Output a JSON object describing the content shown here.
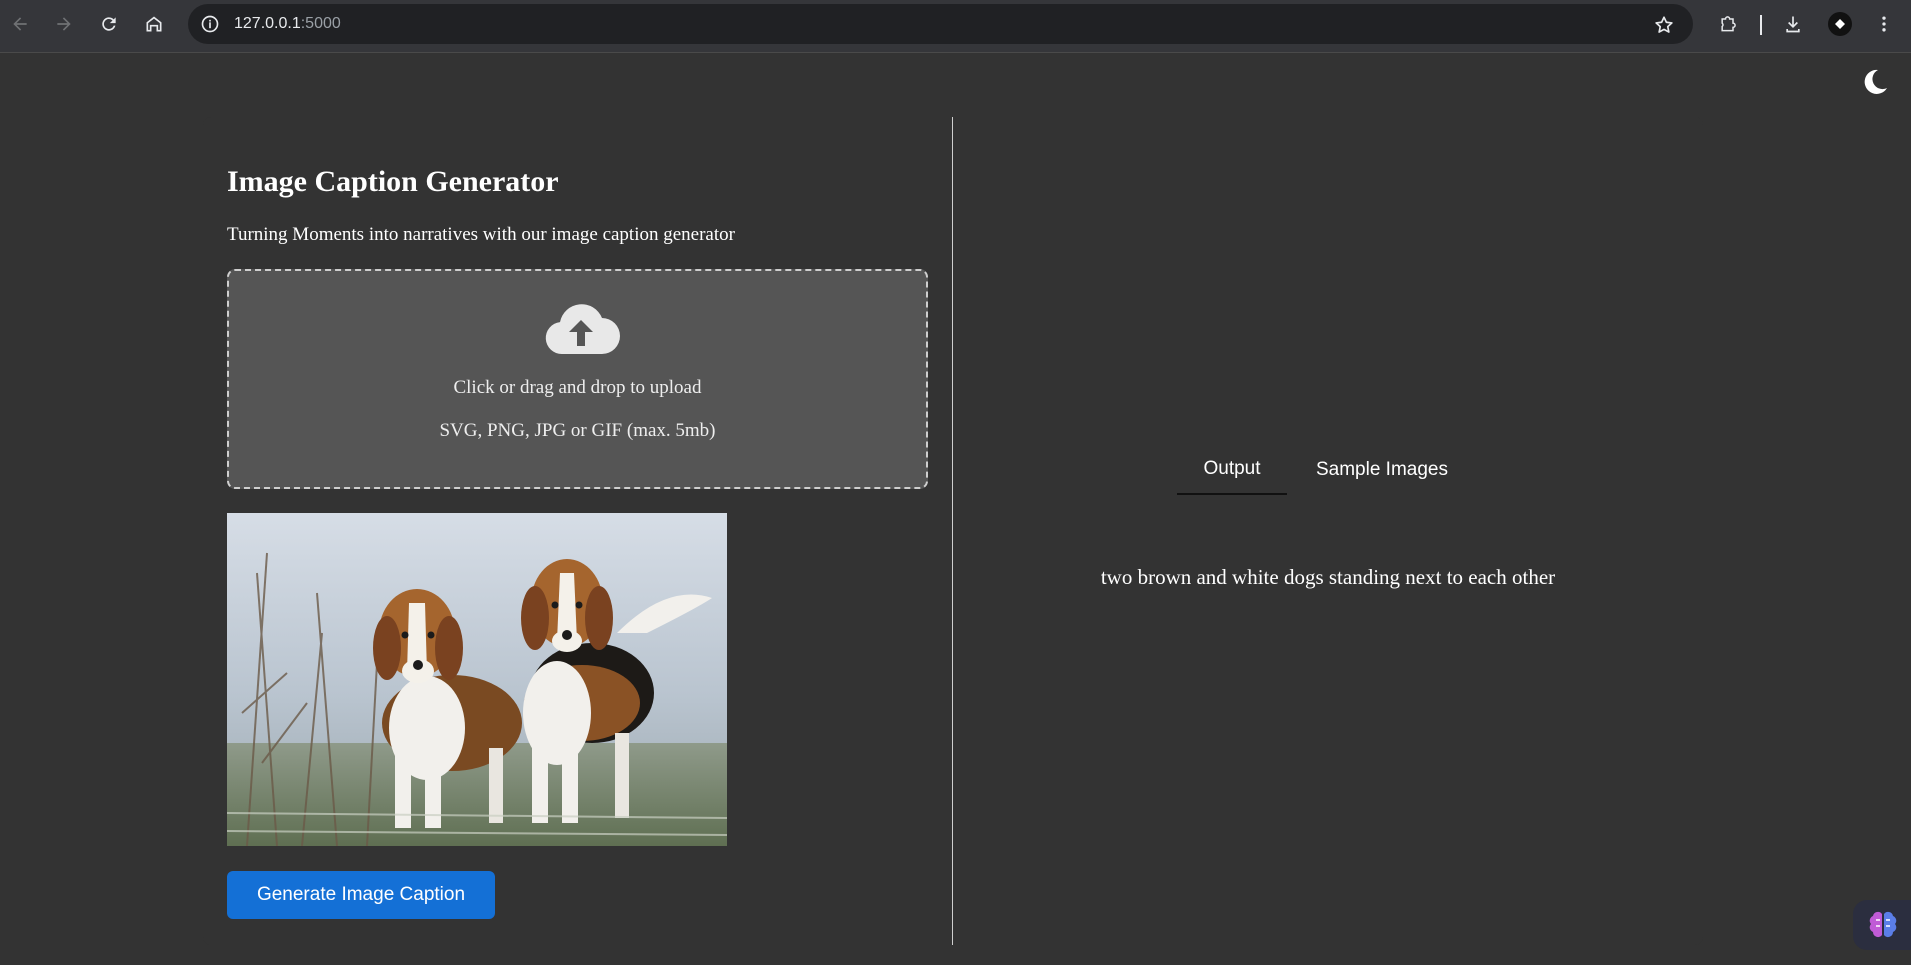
{
  "browser": {
    "url_host": "127.0.0.1",
    "url_port": ":5000"
  },
  "app": {
    "title": "Image Caption Generator",
    "subtitle": "Turning Moments into narratives with our image caption generator"
  },
  "upload": {
    "instruction": "Click or drag and drop to upload",
    "formats": "SVG, PNG, JPG or GIF (max. 5mb)"
  },
  "generate_button": {
    "label": "Generate Image Caption"
  },
  "tabs": [
    {
      "label": "Output",
      "active": true
    },
    {
      "label": "Sample Images",
      "active": false
    }
  ],
  "output": {
    "caption": "two brown and white dogs standing next to each other"
  },
  "colors": {
    "background": "#333333",
    "dropzone": "#555555",
    "button": "#1470d6"
  }
}
